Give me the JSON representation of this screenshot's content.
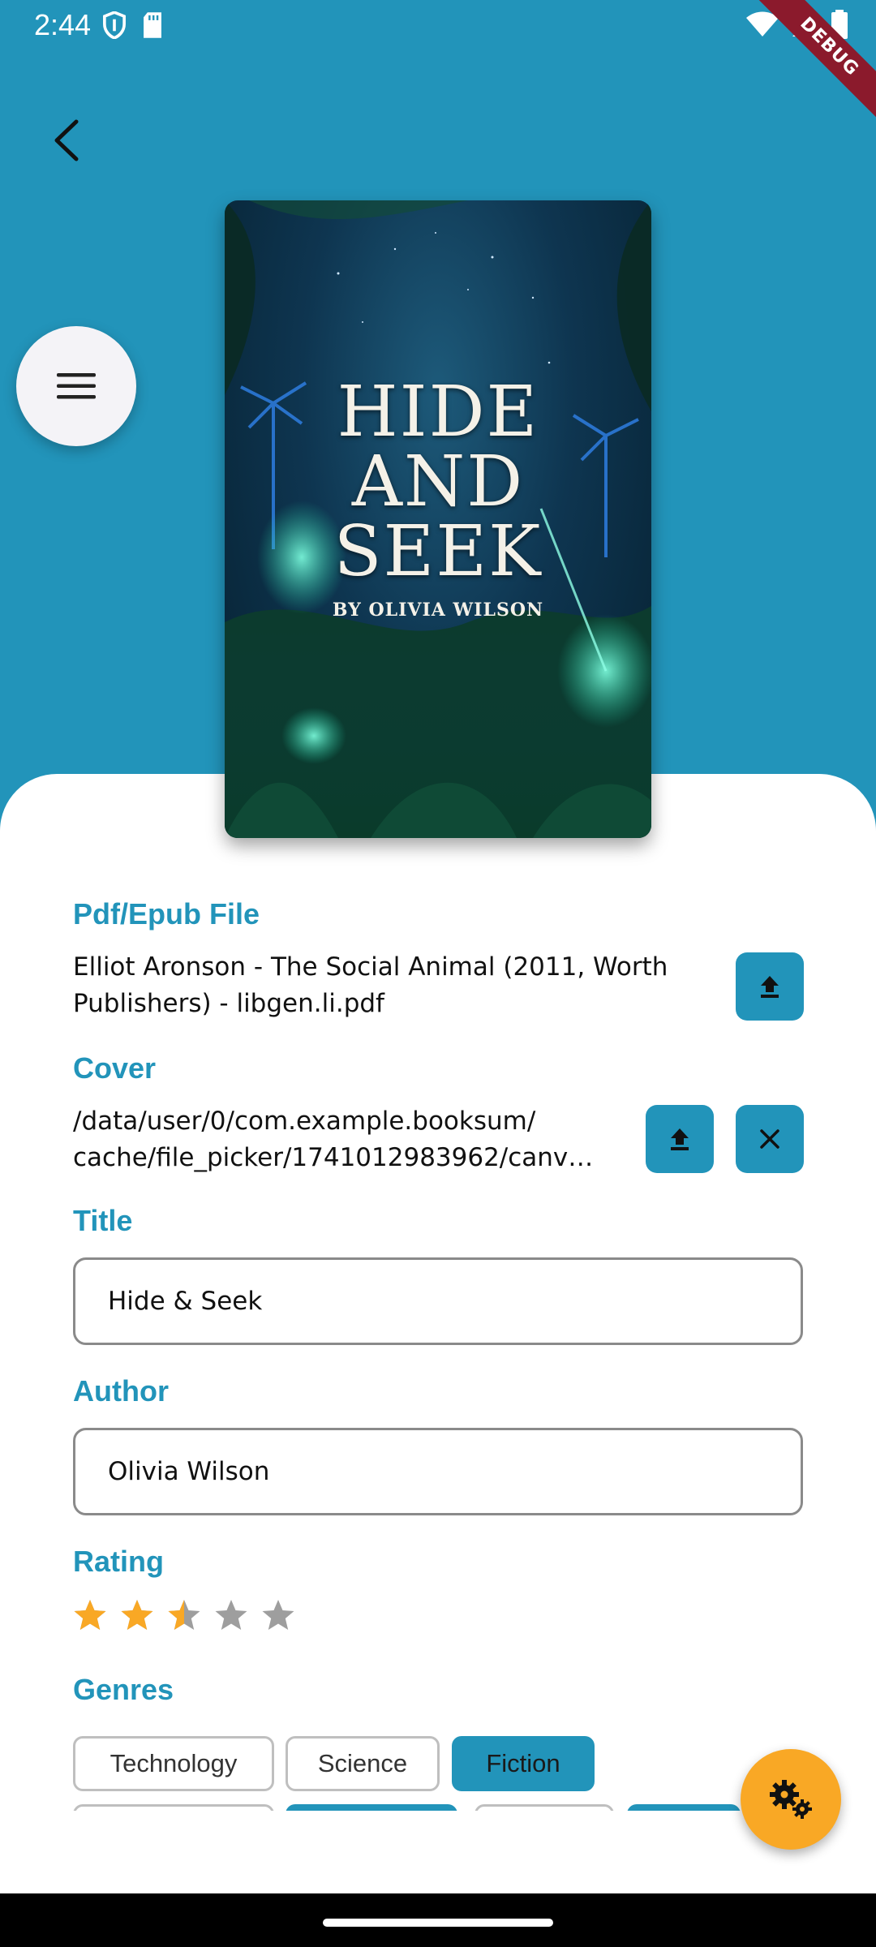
{
  "status_bar": {
    "time": "2:44",
    "icons_left": [
      "shield-icon",
      "sd-card-icon"
    ],
    "icons_right": [
      "wifi-icon",
      "signal-icon",
      "battery-icon"
    ]
  },
  "debug_banner": "DEBUG",
  "book_cover": {
    "title_lines": [
      "HIDE",
      "AND",
      "SEEK"
    ],
    "author_line": "BY OLIVIA WILSON"
  },
  "form": {
    "file_label": "Pdf/Epub File",
    "file_name": "Elliot Aronson - The Social Animal (2011, Worth Publishers) - libgen.li.pdf",
    "cover_label": "Cover",
    "cover_path_line1": "/data/user/0/com.example.booksum/",
    "cover_path_line2": "cache/file_picker/1741012983962/canv…",
    "title_label": "Title",
    "title_value": "Hide & Seek",
    "author_label": "Author",
    "author_value": "Olivia Wilson",
    "rating_label": "Rating",
    "rating_value": 2.5,
    "rating_max": 5,
    "genres_label": "Genres",
    "genres": [
      {
        "label": "Technology",
        "selected": false
      },
      {
        "label": "Science",
        "selected": false
      },
      {
        "label": "Fiction",
        "selected": true
      }
    ]
  },
  "colors": {
    "primary": "#2294BA",
    "star_filled": "#F9A825",
    "star_empty": "#9E9E9E",
    "fab": "#F9A825",
    "debug": "#8B1A2C"
  }
}
